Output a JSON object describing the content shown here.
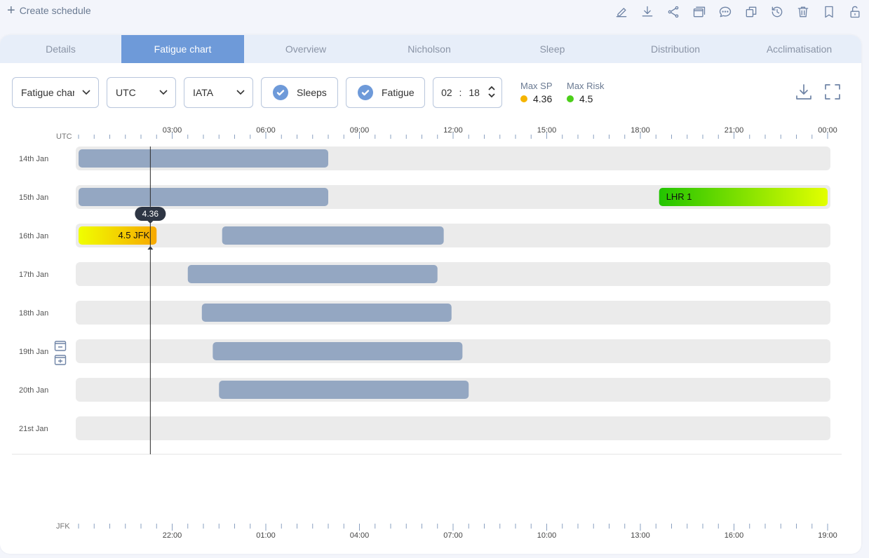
{
  "topbar": {
    "create_label": "Create schedule",
    "icons": [
      "edit-icon",
      "download-icon",
      "share-icon",
      "window-icon",
      "comment-icon",
      "copy-icon",
      "history-icon",
      "trash-icon",
      "bookmark-icon",
      "unlock-icon"
    ]
  },
  "tabs": [
    {
      "label": "Details",
      "active": false
    },
    {
      "label": "Fatigue chart",
      "active": true
    },
    {
      "label": "Overview",
      "active": false
    },
    {
      "label": "Nicholson",
      "active": false
    },
    {
      "label": "Sleep",
      "active": false
    },
    {
      "label": "Distribution",
      "active": false
    },
    {
      "label": "Acclimatisation",
      "active": false
    }
  ],
  "controls": {
    "view_select": "Fatigue chart",
    "tz_select": "UTC",
    "code_select": "IATA",
    "sleeps_label": "Sleeps",
    "sleeps_checked": true,
    "fatigue_label": "Fatigue",
    "fatigue_checked": true,
    "time_hours": "02",
    "time_sep": ":",
    "time_minutes": "18"
  },
  "stats": {
    "max_sp_label": "Max SP",
    "max_sp_value": "4.36",
    "max_sp_color": "#f5b400",
    "max_risk_label": "Max Risk",
    "max_risk_value": "4.5",
    "max_risk_color": "#4ccf1a"
  },
  "chart_data": {
    "type": "timeline",
    "top_axis": {
      "tz": "UTC",
      "ticks": [
        "03:00",
        "06:00",
        "09:00",
        "12:00",
        "15:00",
        "18:00",
        "21:00",
        "00:00"
      ]
    },
    "bottom_axis": {
      "tz": "JFK",
      "ticks": [
        "22:00",
        "01:00",
        "04:00",
        "07:00",
        "10:00",
        "13:00",
        "16:00",
        "19:00"
      ]
    },
    "hours_span": 24,
    "days": [
      {
        "label": "14th Jan",
        "sleeps": [
          [
            0,
            8.0
          ]
        ],
        "duties": []
      },
      {
        "label": "15th Jan",
        "sleeps": [
          [
            0,
            8.0
          ]
        ],
        "duties": [
          {
            "start": 18.6,
            "end": 24,
            "label": "LHR 1",
            "from": "#22c400",
            "to": "#e3ff00"
          }
        ]
      },
      {
        "label": "16th Jan",
        "sleeps": [
          [
            4.6,
            11.7
          ]
        ],
        "duties": [
          {
            "start": 0,
            "end": 2.5,
            "label": "4.5 JFK",
            "from": "#f0ff00",
            "to": "#f7a800"
          }
        ]
      },
      {
        "label": "17th Jan",
        "sleeps": [
          [
            3.5,
            11.5
          ]
        ],
        "duties": []
      },
      {
        "label": "18th Jan",
        "sleeps": [
          [
            3.95,
            11.95
          ]
        ],
        "duties": []
      },
      {
        "label": "19th Jan",
        "sleeps": [
          [
            4.3,
            12.3
          ]
        ],
        "duties": []
      },
      {
        "label": "20th Jan",
        "sleeps": [
          [
            4.5,
            12.5
          ]
        ],
        "duties": []
      },
      {
        "label": "21st Jan",
        "sleeps": [],
        "duties": []
      }
    ],
    "cursor": {
      "time": 2.3,
      "value": "4.36"
    }
  }
}
